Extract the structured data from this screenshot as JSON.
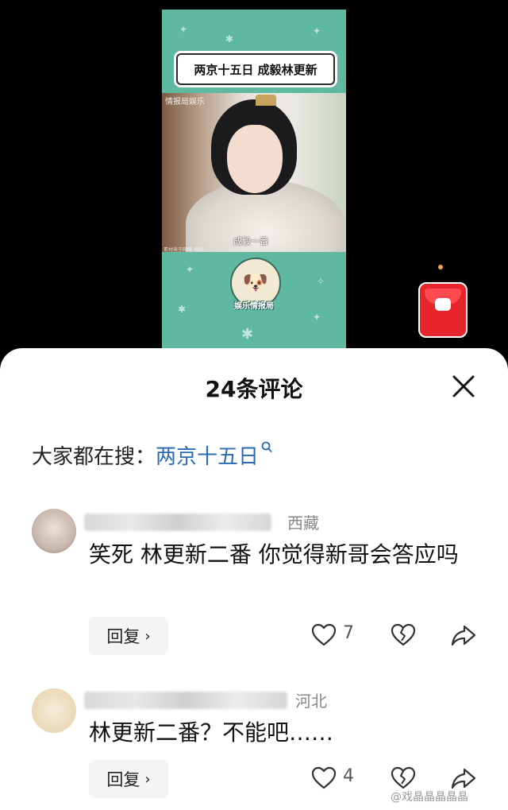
{
  "video": {
    "title": "两京十五日 成毅林更新",
    "watermark_top": "情报局娱乐",
    "subtitle": "成毅一番",
    "watermark_bottom": "素材来于网络 侵删",
    "channel_name": "娱乐情报局"
  },
  "comments_sheet": {
    "title": "24条评论",
    "trending_label": "大家都在搜：",
    "trending_term": "两京十五日",
    "comments": [
      {
        "location": "西藏",
        "text": "笑死 林更新二番 你觉得新哥会答应吗",
        "reply_label": "回复",
        "likes": "7"
      },
      {
        "location": "河北",
        "text": "林更新二番？不能吧……",
        "reply_label": "回复",
        "likes": "4"
      }
    ]
  },
  "footer_watermark": "@戏晶晶晶晶晶",
  "colors": {
    "video_bg": "#5fb8a0",
    "link": "#2a6bb5",
    "red_packet": "#e8242c"
  },
  "icons": [
    "close-icon",
    "search-icon",
    "heart-icon",
    "broken-heart-icon",
    "share-icon",
    "chevron-right-icon",
    "red-packet-icon"
  ]
}
